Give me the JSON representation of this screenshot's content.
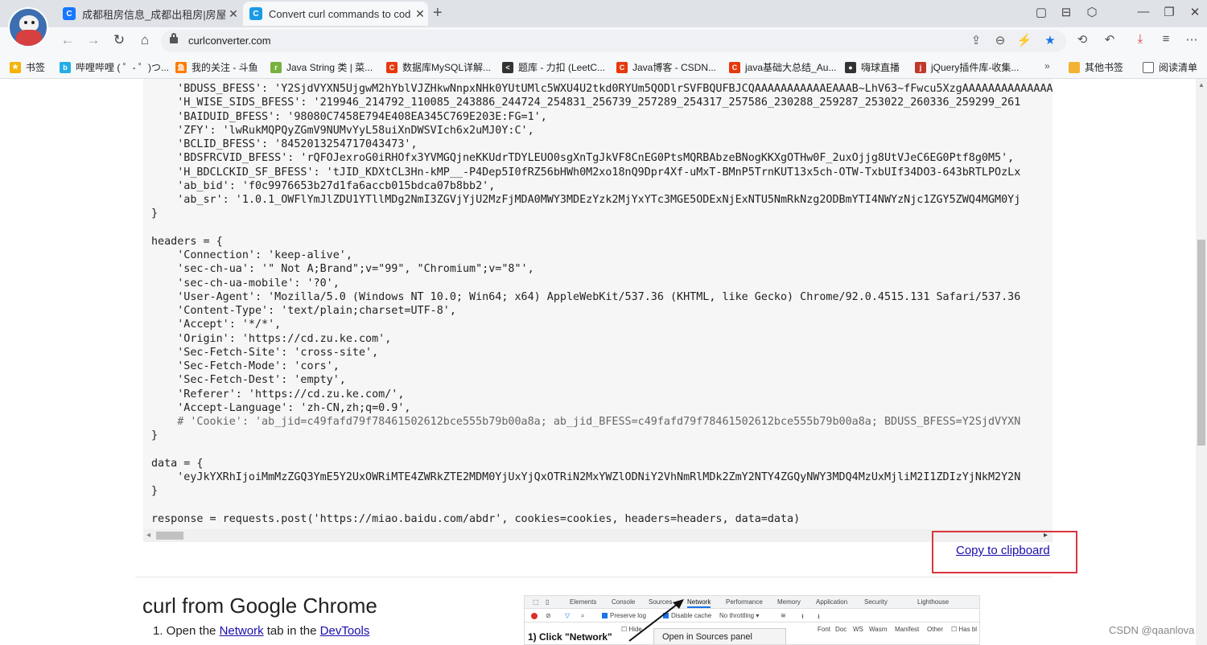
{
  "browser": {
    "tabs": [
      {
        "label": "成都租房信息_成都出租房|房屋",
        "icon": "ke-favicon-icon",
        "icon_color": "#1677ff",
        "icon_glyph": "C",
        "active": false
      },
      {
        "label": "Convert curl commands to cod",
        "icon": "curlconverter-favicon-icon",
        "icon_color": "#1a9be6",
        "icon_glyph": "C",
        "active": true
      }
    ],
    "new_tab": "+",
    "url": "curlconverter.com",
    "bookmarks": [
      {
        "label": "书签",
        "icon": "star-icon",
        "color": "#f4b400",
        "glyph": "★"
      },
      {
        "label": "哔哩哔哩 ( ゜- ゜)つ...",
        "icon": "bilibili-icon",
        "color": "#23ade5",
        "glyph": "b"
      },
      {
        "label": "我的关注 - 斗鱼",
        "icon": "douyu-icon",
        "color": "#ff7a00",
        "glyph": "鱼"
      },
      {
        "label": "Java String 类 | 菜...",
        "icon": "runoob-icon",
        "color": "#78b13f",
        "glyph": "r"
      },
      {
        "label": "数据库MySQL详解...",
        "icon": "csdn-icon",
        "color": "#e8380d",
        "glyph": "C"
      },
      {
        "label": "题库 - 力扣 (LeetC...",
        "icon": "leetcode-icon",
        "color": "#333333",
        "glyph": "<"
      },
      {
        "label": "Java博客 - CSDN...",
        "icon": "csdn-icon",
        "color": "#e8380d",
        "glyph": "C"
      },
      {
        "label": "java基础大总结_Au...",
        "icon": "csdn-icon",
        "color": "#e8380d",
        "glyph": "C"
      },
      {
        "label": "嗨球直播",
        "icon": "haiqiu-icon",
        "color": "#333333",
        "glyph": "●"
      },
      {
        "label": "jQuery插件库-收集...",
        "icon": "jquery-icon",
        "color": "#c0392b",
        "glyph": "j"
      }
    ],
    "bookmarks_more": "»",
    "other_bookmarks": "其他书签",
    "reading_list": "阅读清单"
  },
  "code_lines": [
    {
      "t": "    'BDUSS_BFESS': 'Y2SjdVYXN5UjgwM2hYblVJZHkwNnpxNHk0YUtUMlc5WXU4U2tkd0RYUm5QODlrSVFBQUFBJCQAAAAAAAAAAAEAAAB~LhV63~fFwcu5XzgAAAAAAAAAAAAAAAAAAAAAAAAAAAAAAAAAAAAAAAAAAAAAAAA",
      "c": false
    },
    {
      "t": "    'H_WISE_SIDS_BFESS': '219946_214792_110085_243886_244724_254831_256739_257289_254317_257586_230288_259287_253022_260336_259299_261",
      "c": false
    },
    {
      "t": "    'BAIDUID_BFESS': '98080C7458E794E408EA345C769E203E:FG=1',",
      "c": false
    },
    {
      "t": "    'ZFY': 'lwRukMQPQyZGmV9NUMvYyL58uiXnDWSVIch6x2uMJ0Y:C',",
      "c": false
    },
    {
      "t": "    'BCLID_BFESS': '8452013254717043473',",
      "c": false
    },
    {
      "t": "    'BDSFRCVID_BFESS': 'rQFOJexroG0iRHOfx3YVMGQjneKKUdrTDYLEUO0sgXnTgJkVF8CnEG0PtsMQRBAbzeBNogKKXgOTHw0F_2uxOjjg8UtVJeC6EG0Ptf8g0M5',",
      "c": false
    },
    {
      "t": "    'H_BDCLCKID_SF_BFESS': 'tJID_KDXtCL3Hn-kMP__-P4Dep5I0fRZ56bHWh0M2xo18nQ9Dpr4Xf-uMxT-BMnP5TrnKUT13x5ch-OTW-TxbUIf34DO3-643bRTLPOzLx",
      "c": false
    },
    {
      "t": "    'ab_bid': 'f0c9976653b27d1fa6accb015bdca07b8bb2',",
      "c": false
    },
    {
      "t": "    'ab_sr': '1.0.1_OWFlYmJlZDU1YTllMDg2NmI3ZGVjYjU2MzFjMDA0MWY3MDEzYzk2MjYxYTc3MGE5ODExNjExNTU5NmRkNzg2ODBmYTI4NWYzNjc1ZGY5ZWQ4MGM0Yj",
      "c": false
    },
    {
      "t": "}",
      "c": false
    },
    {
      "t": "",
      "c": false
    },
    {
      "t": "headers = {",
      "c": false
    },
    {
      "t": "    'Connection': 'keep-alive',",
      "c": false
    },
    {
      "t": "    'sec-ch-ua': '\" Not A;Brand\";v=\"99\", \"Chromium\";v=\"8\"',",
      "c": false
    },
    {
      "t": "    'sec-ch-ua-mobile': '?0',",
      "c": false
    },
    {
      "t": "    'User-Agent': 'Mozilla/5.0 (Windows NT 10.0; Win64; x64) AppleWebKit/537.36 (KHTML, like Gecko) Chrome/92.0.4515.131 Safari/537.36",
      "c": false
    },
    {
      "t": "    'Content-Type': 'text/plain;charset=UTF-8',",
      "c": false
    },
    {
      "t": "    'Accept': '*/*',",
      "c": false
    },
    {
      "t": "    'Origin': 'https://cd.zu.ke.com',",
      "c": false
    },
    {
      "t": "    'Sec-Fetch-Site': 'cross-site',",
      "c": false
    },
    {
      "t": "    'Sec-Fetch-Mode': 'cors',",
      "c": false
    },
    {
      "t": "    'Sec-Fetch-Dest': 'empty',",
      "c": false
    },
    {
      "t": "    'Referer': 'https://cd.zu.ke.com/',",
      "c": false
    },
    {
      "t": "    'Accept-Language': 'zh-CN,zh;q=0.9',",
      "c": false
    },
    {
      "t": "    # 'Cookie': 'ab_jid=c49fafd79f78461502612bce555b79b00a8a; ab_jid_BFESS=c49fafd79f78461502612bce555b79b00a8a; BDUSS_BFESS=Y2SjdVYXN",
      "c": true
    },
    {
      "t": "}",
      "c": false
    },
    {
      "t": "",
      "c": false
    },
    {
      "t": "data = {",
      "c": false
    },
    {
      "t": "    'eyJkYXRhIjoiMmMzZGQ3YmE5Y2UxOWRiMTE4ZWRkZTE2MDM0YjUxYjQxOTRiN2MxYWZlODNiY2VhNmRlMDk2ZmY2NTY4ZGQyNWY3MDQ4MzUxMjliM2I1ZDIzYjNkM2Y2N",
      "c": false
    },
    {
      "t": "}",
      "c": false
    },
    {
      "t": "",
      "c": false
    },
    {
      "t": "response = requests.post('https://miao.baidu.com/abdr', cookies=cookies, headers=headers, data=data)",
      "c": false
    }
  ],
  "copy_link": "Copy to clipboard",
  "section": {
    "title": "curl from Google Chrome",
    "step1_prefix": "1. Open the ",
    "step1_link1": "Network",
    "step1_mid": " tab in the ",
    "step1_link2": "DevTools"
  },
  "devtools": {
    "tabs": [
      "Elements",
      "Console",
      "Sources",
      "Network",
      "Performance",
      "Memory",
      "Application",
      "Security",
      "Lighthouse"
    ],
    "preserve_log": "Preserve log",
    "disable_cache": "Disable cache",
    "throttling": "No throttling",
    "filters": [
      "Font",
      "Doc",
      "WS",
      "Wasm",
      "Manifest",
      "Other"
    ],
    "has_blocked": "Has bl",
    "hide": "Hide",
    "popup": "Open in Sources panel",
    "callout": "1) Click \"Network\""
  },
  "watermark": "CSDN @qaanlova",
  "colors": {
    "link": "#1a0dab",
    "highlight_box": "#d9363e",
    "code_bg": "#f6f6f6"
  }
}
